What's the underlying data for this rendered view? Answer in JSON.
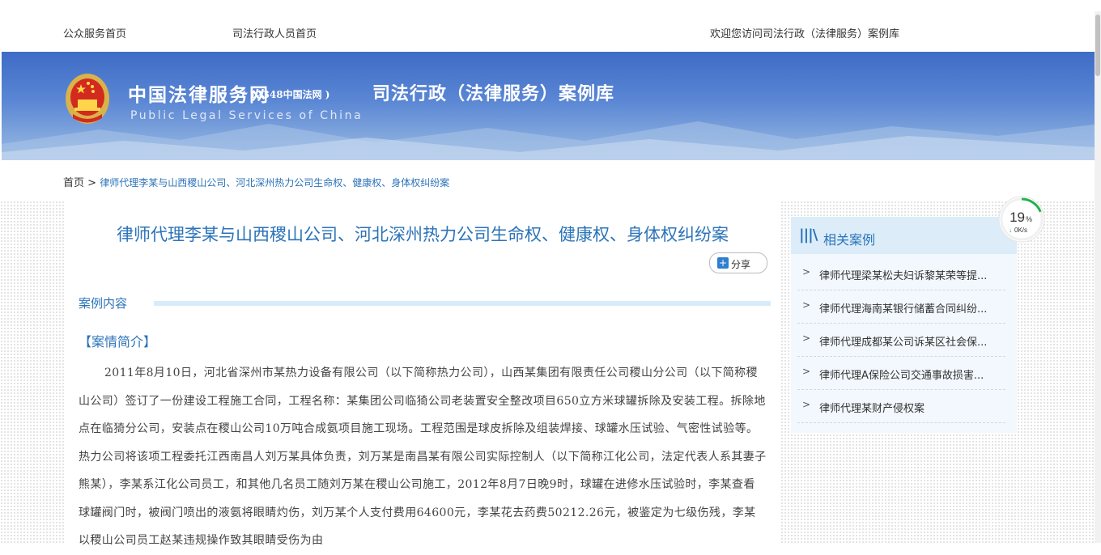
{
  "topnav": {
    "public_home": "公众服务首页",
    "staff_home": "司法行政人员首页",
    "welcome": "欢迎您访问司法行政（法律服务）案例库"
  },
  "banner": {
    "site_name": "中国法律服务网",
    "site_sub": "( 12348中国法网 )",
    "site_en": "Public Legal Services of China",
    "library_name": "司法行政（法律服务）案例库"
  },
  "breadcrumb": {
    "home": "首页",
    "separator": ">",
    "current": "律师代理李某与山西稷山公司、河北深州热力公司生命权、健康权、身体权纠纷案"
  },
  "article": {
    "title": "律师代理李某与山西稷山公司、河北深州热力公司生命权、健康权、身体权纠纷案",
    "share_label": "分享",
    "section_label": "案例内容",
    "sub_heading": "【案情简介】",
    "body": "2011年8月10日，河北省深州市某热力设备有限公司（以下简称热力公司），山西某集团有限责任公司稷山分公司（以下简称稷山公司）签订了一份建设工程施工合同，工程名称：某集团公司临猗公司老装置安全整改项目650立方米球罐拆除及安装工程。拆除地点在临猗分公司，安装点在稷山公司10万吨合成氨项目施工现场。工程范围是球皮拆除及组装焊接、球罐水压试验、气密性试验等。热力公司将该项工程委托江西南昌人刘万某具体负责，刘万某是南昌某有限公司实际控制人（以下简称江化公司，法定代表人系其妻子熊某），李某系江化公司员工，和其他几名员工随刘万某在稷山公司施工，2012年8月7日晚9时，球罐在进修水压试验时，李某查看球罐阀门时，被阀门喷出的液氨将眼睛灼伤，刘万某个人支付费用64600元，李某花去药费50212.26元，被鉴定为七级伤残，李某以稷山公司员工赵某违规操作致其眼睛受伤为由"
  },
  "related": {
    "title": "相关案例",
    "items": [
      "律师代理梁某松夫妇诉黎某荣等提...",
      "律师代理海南某银行储蓄合同纠纷...",
      "律师代理成都某公司诉某区社会保...",
      "律师代理A保险公司交通事故损害...",
      "律师代理某财产侵权案"
    ]
  },
  "speed_widget": {
    "percent": "19",
    "percent_sign": "%",
    "rate": "0K/s",
    "fraction": 0.19,
    "color": "#22b14c"
  },
  "colors": {
    "link_blue": "#2b73b8",
    "banner_blue": "#4a78cc"
  }
}
